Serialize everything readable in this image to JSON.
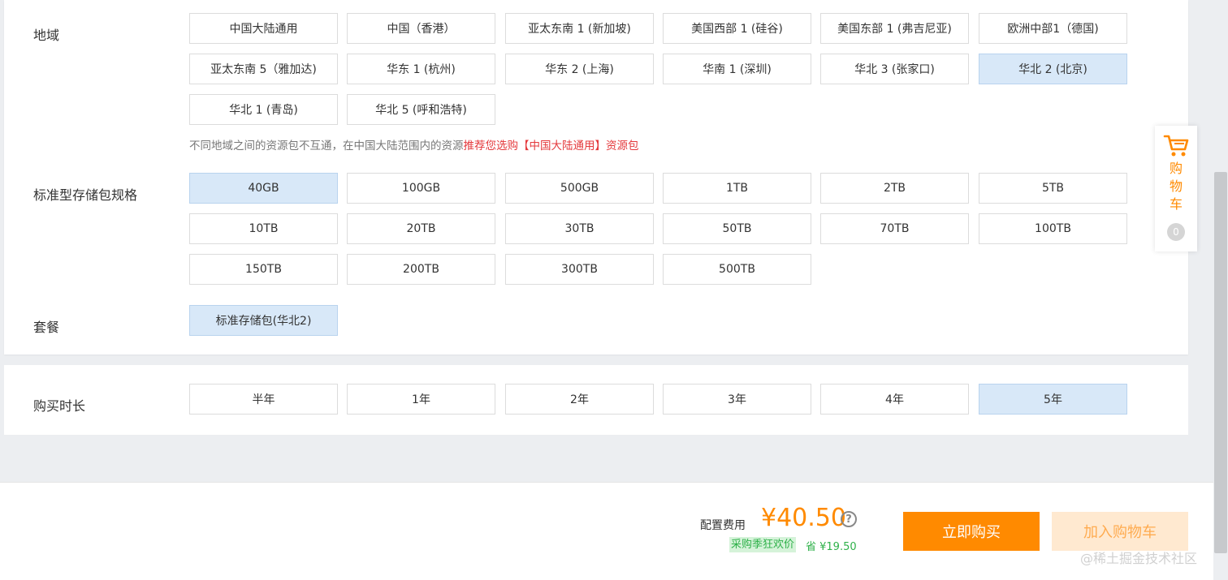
{
  "region": {
    "label": "地域",
    "options": [
      {
        "label": "中国大陆通用",
        "selected": false
      },
      {
        "label": "中国（香港）",
        "selected": false
      },
      {
        "label": "亚太东南 1 (新加坡)",
        "selected": false
      },
      {
        "label": "美国西部 1 (硅谷)",
        "selected": false
      },
      {
        "label": "美国东部 1 (弗吉尼亚)",
        "selected": false
      },
      {
        "label": "欧洲中部1（德国)",
        "selected": false
      },
      {
        "label": "亚太东南 5（雅加达)",
        "selected": false
      },
      {
        "label": "华东 1 (杭州)",
        "selected": false
      },
      {
        "label": "华东 2 (上海)",
        "selected": false
      },
      {
        "label": "华南 1 (深圳)",
        "selected": false
      },
      {
        "label": "华北 3 (张家口)",
        "selected": false
      },
      {
        "label": "华北 2 (北京)",
        "selected": true
      },
      {
        "label": "华北 1 (青岛)",
        "selected": false
      },
      {
        "label": "华北 5 (呼和浩特)",
        "selected": false
      }
    ],
    "hint_text": "不同地域之间的资源包不互通，在中国大陆范围内的资源",
    "hint_red": "推荐您选购【中国大陆通用】资源包"
  },
  "storage": {
    "label": "标准型存储包规格",
    "options": [
      {
        "label": "40GB",
        "selected": true
      },
      {
        "label": "100GB",
        "selected": false
      },
      {
        "label": "500GB",
        "selected": false
      },
      {
        "label": "1TB",
        "selected": false
      },
      {
        "label": "2TB",
        "selected": false
      },
      {
        "label": "5TB",
        "selected": false
      },
      {
        "label": "10TB",
        "selected": false
      },
      {
        "label": "20TB",
        "selected": false
      },
      {
        "label": "30TB",
        "selected": false
      },
      {
        "label": "50TB",
        "selected": false
      },
      {
        "label": "70TB",
        "selected": false
      },
      {
        "label": "100TB",
        "selected": false
      },
      {
        "label": "150TB",
        "selected": false
      },
      {
        "label": "200TB",
        "selected": false
      },
      {
        "label": "300TB",
        "selected": false
      },
      {
        "label": "500TB",
        "selected": false
      }
    ]
  },
  "package": {
    "label": "套餐",
    "options": [
      {
        "label": "标准存储包(华北2)",
        "selected": true
      }
    ]
  },
  "duration": {
    "label": "购买时长",
    "options": [
      {
        "label": "半年",
        "selected": false
      },
      {
        "label": "1年",
        "selected": false
      },
      {
        "label": "2年",
        "selected": false
      },
      {
        "label": "3年",
        "selected": false
      },
      {
        "label": "4年",
        "selected": false
      },
      {
        "label": "5年",
        "selected": true
      }
    ]
  },
  "cart": {
    "label": "购物车",
    "count": "0",
    "icon": "shopping-cart-icon",
    "color": "#ff8a00"
  },
  "footer": {
    "fee_label": "配置费用",
    "price": "¥40.50",
    "help_symbol": "?",
    "promo": "采购季狂欢价",
    "save": "省 ¥19.50",
    "buy_label": "立即购买",
    "add_cart_label": "加入购物车",
    "watermark": "@稀土掘金技术社区"
  },
  "colors": {
    "accent": "#ff8a00",
    "selected_bg": "#d8e8f8",
    "hint_red": "#e4393c",
    "promo_green": "#2fb14a"
  }
}
